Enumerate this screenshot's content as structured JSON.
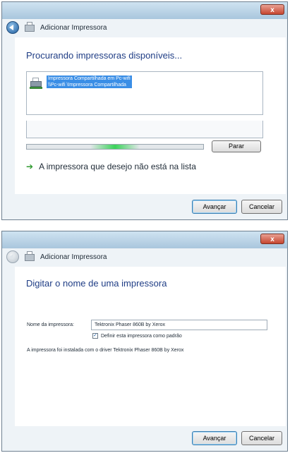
{
  "window1": {
    "title": "Adicionar Impressora",
    "heading": "Procurando impressoras disponíveis...",
    "printer_item_line1": "Impressora Compartilhada em Pc-wifi",
    "printer_item_line2": "\\\\Pc-wifi \\Impressora Compartilhada",
    "stop_button": "Parar",
    "missing_printer_link": "A impressora que desejo não está na lista",
    "next_button": "Avançar",
    "cancel_button": "Cancelar"
  },
  "window2": {
    "title": "Adicionar Impressora",
    "heading": "Digitar o nome de uma impressora",
    "printer_name_label": "Nome da impressora:",
    "printer_name_value": "Tektronix Phaser 860B by Xerox",
    "default_checkbox_label": "Definir esta impressora como padrão",
    "default_checked": true,
    "driver_info": "A impressora foi instalada com o driver Tektronix Phaser 860B by Xerox",
    "next_button": "Avançar",
    "cancel_button": "Cancelar"
  },
  "close_glyph": "x",
  "check_glyph": "✓",
  "arrow_glyph": "➔",
  "colors": {
    "heading": "#1f3d85",
    "selection": "#3a8ee6",
    "arrow": "#2f9a2f",
    "progress_glow": "#3bd35a"
  }
}
